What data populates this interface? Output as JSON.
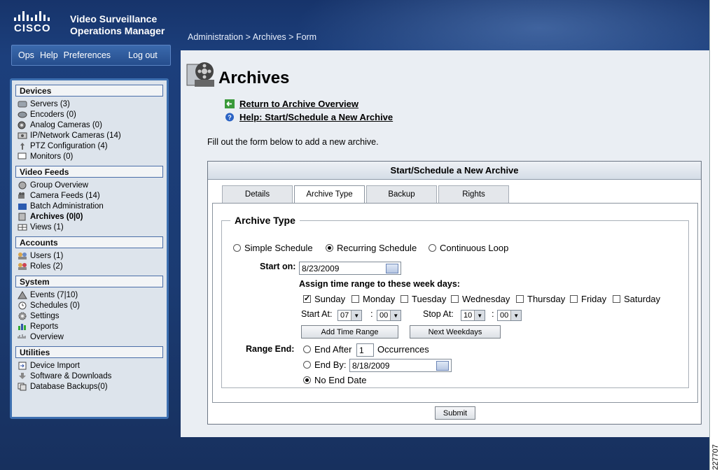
{
  "header": {
    "brand": "CISCO",
    "product_line1": "Video Surveillance",
    "product_line2": "Operations Manager",
    "breadcrumb": "Administration > Archives > Form"
  },
  "topnav": {
    "ops": "Ops",
    "help": "Help",
    "preferences": "Preferences",
    "logout": "Log out"
  },
  "sidebar": {
    "devices": {
      "title": "Devices",
      "items": [
        "Servers (3)",
        "Encoders (0)",
        "Analog Cameras (0)",
        "IP/Network Cameras (14)",
        "PTZ Configuration (4)",
        "Monitors (0)"
      ]
    },
    "video_feeds": {
      "title": "Video Feeds",
      "items": [
        "Group Overview",
        "Camera Feeds (14)",
        "Batch Administration",
        "Archives (0|0)",
        "Views (1)"
      ]
    },
    "accounts": {
      "title": "Accounts",
      "items": [
        "Users (1)",
        "Roles (2)"
      ]
    },
    "system": {
      "title": "System",
      "items": [
        "Events (7|10)",
        "Schedules (0)",
        "Settings",
        "Reports",
        "Overview"
      ]
    },
    "utilities": {
      "title": "Utilities",
      "items": [
        "Device Import",
        "Software & Downloads",
        "Database Backups(0)"
      ]
    }
  },
  "main": {
    "title": "Archives",
    "link_return": "Return to Archive Overview",
    "link_help": "Help: Start/Schedule a New Archive",
    "intro": "Fill out the form below to add a new archive."
  },
  "panel": {
    "title": "Start/Schedule a New Archive",
    "tabs": [
      "Details",
      "Archive Type",
      "Backup",
      "Rights"
    ],
    "active_tab": "Archive Type"
  },
  "form": {
    "legend": "Archive Type",
    "types": [
      "Simple Schedule",
      "Recurring Schedule",
      "Continuous Loop"
    ],
    "selected_type": "Recurring Schedule",
    "start_on_label": "Start on:",
    "start_on_value": "8/23/2009",
    "assign_label": "Assign time range to these week days:",
    "weekdays": [
      "Sunday",
      "Monday",
      "Tuesday",
      "Wednesday",
      "Thursday",
      "Friday",
      "Saturday"
    ],
    "weekdays_checked": [
      "Sunday"
    ],
    "start_at_label": "Start At:",
    "start_hour": "07",
    "start_min": "00",
    "stop_at_label": "Stop At:",
    "stop_hour": "10",
    "stop_min": "00",
    "colon": ":",
    "add_time_range": "Add Time Range",
    "next_weekdays": "Next Weekdays",
    "range_end_label": "Range End:",
    "end_after_label": "End After",
    "end_after_value": "1",
    "occurrences": "Occurrences",
    "end_by_label": "End By:",
    "end_by_value": "8/18/2009",
    "no_end_date": "No End Date",
    "selected_range_end": "No End Date",
    "submit": "Submit"
  },
  "figure_id": "227707",
  "colors": {
    "header_blue": "#1c3f7c",
    "sidebar_border": "#3d6fb0",
    "main_bg": "#eaeef3"
  }
}
